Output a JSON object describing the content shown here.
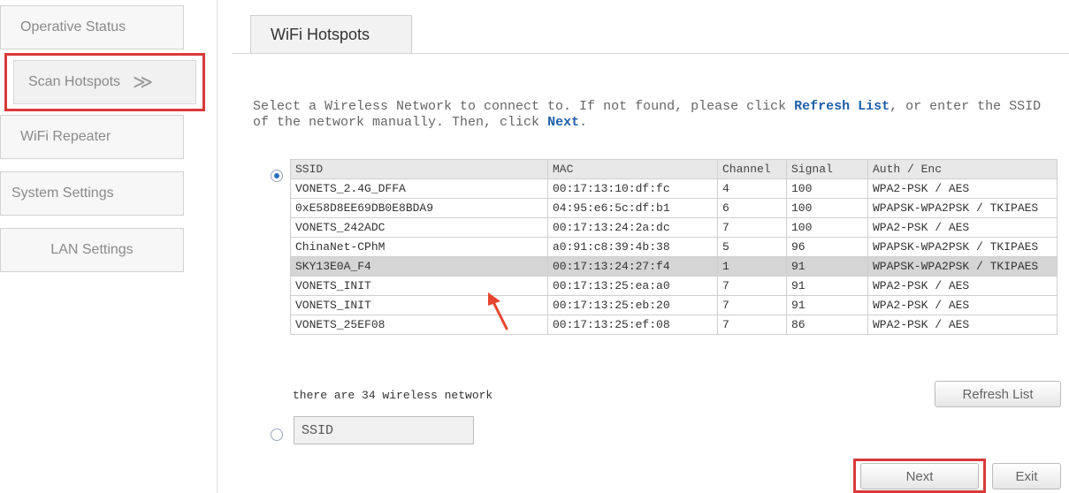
{
  "sidebar": {
    "items": [
      {
        "label": "Operative Status"
      },
      {
        "label": "Scan Hotspots",
        "arrow": "≫"
      },
      {
        "label": "WiFi Repeater"
      },
      {
        "label": "System Settings"
      },
      {
        "label": "LAN Settings"
      }
    ]
  },
  "tab": {
    "label": "WiFi Hotspots"
  },
  "instruction": {
    "part1": "Select a Wireless Network to connect to. If not found, please click ",
    "refresh": "Refresh List",
    "part2": ", or enter the SSID of the network manually. Then, click ",
    "next": "Next",
    "part3": "."
  },
  "table": {
    "headers": [
      "SSID",
      "MAC",
      "Channel",
      "Signal",
      "Auth / Enc"
    ],
    "rows": [
      [
        "VONETS_2.4G_DFFA",
        "00:17:13:10:df:fc",
        "4",
        "100",
        "WPA2-PSK / AES"
      ],
      [
        "0xE58D8EE69DB0E8BDA9",
        "04:95:e6:5c:df:b1",
        "6",
        "100",
        "WPAPSK-WPA2PSK / TKIPAES"
      ],
      [
        "VONETS_242ADC",
        "00:17:13:24:2a:dc",
        "7",
        "100",
        "WPA2-PSK / AES"
      ],
      [
        "ChinaNet-CPhM",
        "a0:91:c8:39:4b:38",
        "5",
        "96",
        "WPAPSK-WPA2PSK / TKIPAES"
      ],
      [
        "SKY13E0A_F4",
        "00:17:13:24:27:f4",
        "1",
        "91",
        "WPAPSK-WPA2PSK / TKIPAES"
      ],
      [
        "VONETS_INIT",
        "00:17:13:25:ea:a0",
        "7",
        "91",
        "WPA2-PSK / AES"
      ],
      [
        "VONETS_INIT",
        "00:17:13:25:eb:20",
        "7",
        "91",
        "WPA2-PSK / AES"
      ],
      [
        "VONETS_25EF08",
        "00:17:13:25:ef:08",
        "7",
        "86",
        "WPA2-PSK / AES"
      ]
    ],
    "selected_row": 4
  },
  "network_count": "there are 34 wireless network",
  "buttons": {
    "refresh": "Refresh List",
    "next": "Next",
    "exit": "Exit"
  },
  "manual": {
    "placeholder": "SSID"
  },
  "colors": {
    "highlight": "#d9393a",
    "link": "#1f5fa8",
    "arrow": "#e8452f"
  },
  "icons": {
    "annotation_arrow": "red-arrow-icon",
    "nav_chevron": "double-chevron-right-icon"
  }
}
